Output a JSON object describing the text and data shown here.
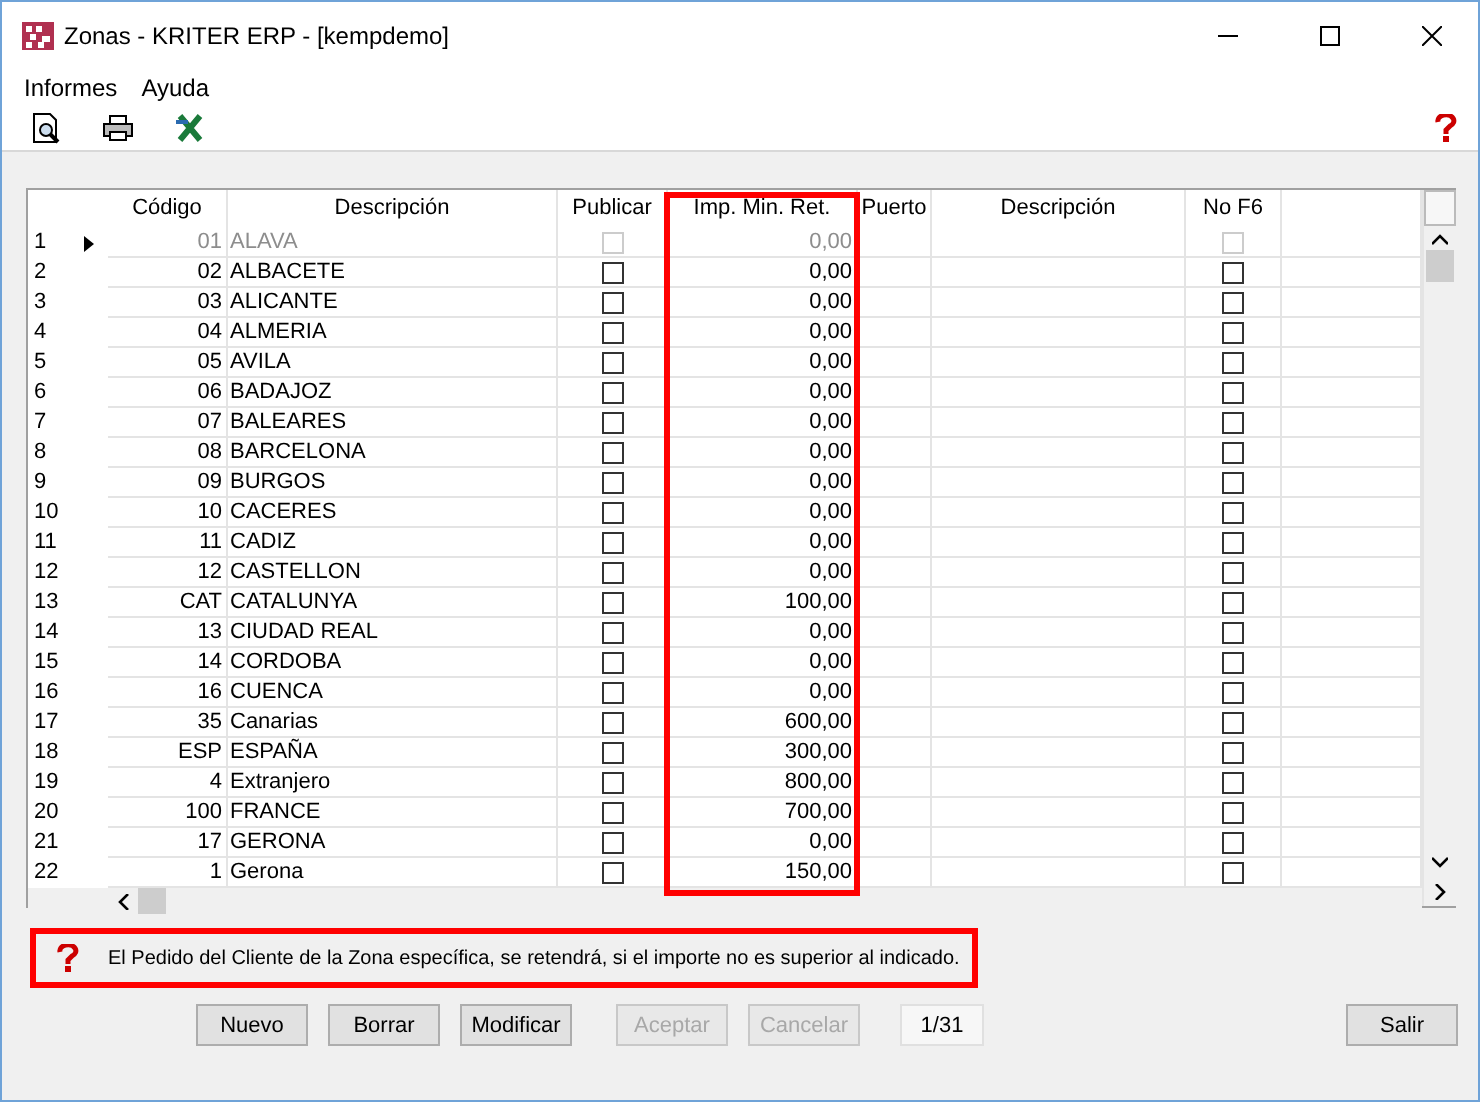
{
  "window": {
    "title": "Zonas - KRITER ERP - [kempdemo]"
  },
  "menu": [
    "Informes",
    "Ayuda"
  ],
  "grid": {
    "columns": [
      {
        "label": "Código",
        "highlighted": false
      },
      {
        "label": "Descripción",
        "highlighted": false
      },
      {
        "label": "Publicar",
        "highlighted": false
      },
      {
        "label": "Imp. Min. Ret.",
        "highlighted": true
      },
      {
        "label": "Puerto",
        "highlighted": false
      },
      {
        "label": "Descripción",
        "highlighted": false
      },
      {
        "label": "No F6",
        "highlighted": false
      }
    ],
    "rows": [
      {
        "n": "1",
        "code": "01",
        "desc": "ALAVA",
        "publicar": false,
        "imp": "0,00",
        "no_f6": false,
        "selected": true,
        "disabled": true
      },
      {
        "n": "2",
        "code": "02",
        "desc": "ALBACETE",
        "publicar": false,
        "imp": "0,00",
        "no_f6": false,
        "selected": false,
        "disabled": false
      },
      {
        "n": "3",
        "code": "03",
        "desc": "ALICANTE",
        "publicar": false,
        "imp": "0,00",
        "no_f6": false,
        "selected": false,
        "disabled": false
      },
      {
        "n": "4",
        "code": "04",
        "desc": "ALMERIA",
        "publicar": false,
        "imp": "0,00",
        "no_f6": false,
        "selected": false,
        "disabled": false
      },
      {
        "n": "5",
        "code": "05",
        "desc": "AVILA",
        "publicar": false,
        "imp": "0,00",
        "no_f6": false,
        "selected": false,
        "disabled": false
      },
      {
        "n": "6",
        "code": "06",
        "desc": "BADAJOZ",
        "publicar": false,
        "imp": "0,00",
        "no_f6": false,
        "selected": false,
        "disabled": false
      },
      {
        "n": "7",
        "code": "07",
        "desc": "BALEARES",
        "publicar": false,
        "imp": "0,00",
        "no_f6": false,
        "selected": false,
        "disabled": false
      },
      {
        "n": "8",
        "code": "08",
        "desc": "BARCELONA",
        "publicar": false,
        "imp": "0,00",
        "no_f6": false,
        "selected": false,
        "disabled": false
      },
      {
        "n": "9",
        "code": "09",
        "desc": "BURGOS",
        "publicar": false,
        "imp": "0,00",
        "no_f6": false,
        "selected": false,
        "disabled": false
      },
      {
        "n": "10",
        "code": "10",
        "desc": "CACERES",
        "publicar": false,
        "imp": "0,00",
        "no_f6": false,
        "selected": false,
        "disabled": false
      },
      {
        "n": "11",
        "code": "11",
        "desc": "CADIZ",
        "publicar": false,
        "imp": "0,00",
        "no_f6": false,
        "selected": false,
        "disabled": false
      },
      {
        "n": "12",
        "code": "12",
        "desc": "CASTELLON",
        "publicar": false,
        "imp": "0,00",
        "no_f6": false,
        "selected": false,
        "disabled": false
      },
      {
        "n": "13",
        "code": "CAT",
        "desc": "CATALUNYA",
        "publicar": false,
        "imp": "100,00",
        "no_f6": false,
        "selected": false,
        "disabled": false
      },
      {
        "n": "14",
        "code": "13",
        "desc": "CIUDAD REAL",
        "publicar": false,
        "imp": "0,00",
        "no_f6": false,
        "selected": false,
        "disabled": false
      },
      {
        "n": "15",
        "code": "14",
        "desc": "CORDOBA",
        "publicar": false,
        "imp": "0,00",
        "no_f6": false,
        "selected": false,
        "disabled": false
      },
      {
        "n": "16",
        "code": "16",
        "desc": "CUENCA",
        "publicar": false,
        "imp": "0,00",
        "no_f6": false,
        "selected": false,
        "disabled": false
      },
      {
        "n": "17",
        "code": "35",
        "desc": "Canarias",
        "publicar": false,
        "imp": "600,00",
        "no_f6": false,
        "selected": false,
        "disabled": false
      },
      {
        "n": "18",
        "code": "ESP",
        "desc": "ESPAÑA",
        "publicar": false,
        "imp": "300,00",
        "no_f6": false,
        "selected": false,
        "disabled": false
      },
      {
        "n": "19",
        "code": "4",
        "desc": "Extranjero",
        "publicar": false,
        "imp": "800,00",
        "no_f6": false,
        "selected": false,
        "disabled": false
      },
      {
        "n": "20",
        "code": "100",
        "desc": "FRANCE",
        "publicar": false,
        "imp": "700,00",
        "no_f6": false,
        "selected": false,
        "disabled": false
      },
      {
        "n": "21",
        "code": "17",
        "desc": "GERONA",
        "publicar": false,
        "imp": "0,00",
        "no_f6": false,
        "selected": false,
        "disabled": false
      },
      {
        "n": "22",
        "code": "1",
        "desc": "Gerona",
        "publicar": false,
        "imp": "150,00",
        "no_f6": false,
        "selected": false,
        "disabled": false
      }
    ]
  },
  "hint": {
    "text": "El Pedido del Cliente de la Zona específica, se retendrá, si el importe no es superior al indicado.",
    "highlighted": true
  },
  "buttons": [
    {
      "label": "Nuevo",
      "disabled": false
    },
    {
      "label": "Borrar",
      "disabled": false
    },
    {
      "label": "Modificar",
      "disabled": false
    },
    {
      "label": "Aceptar",
      "disabled": true
    },
    {
      "label": "Cancelar",
      "disabled": true
    }
  ],
  "record_counter": "1/31",
  "exit_button": {
    "label": "Salir"
  }
}
